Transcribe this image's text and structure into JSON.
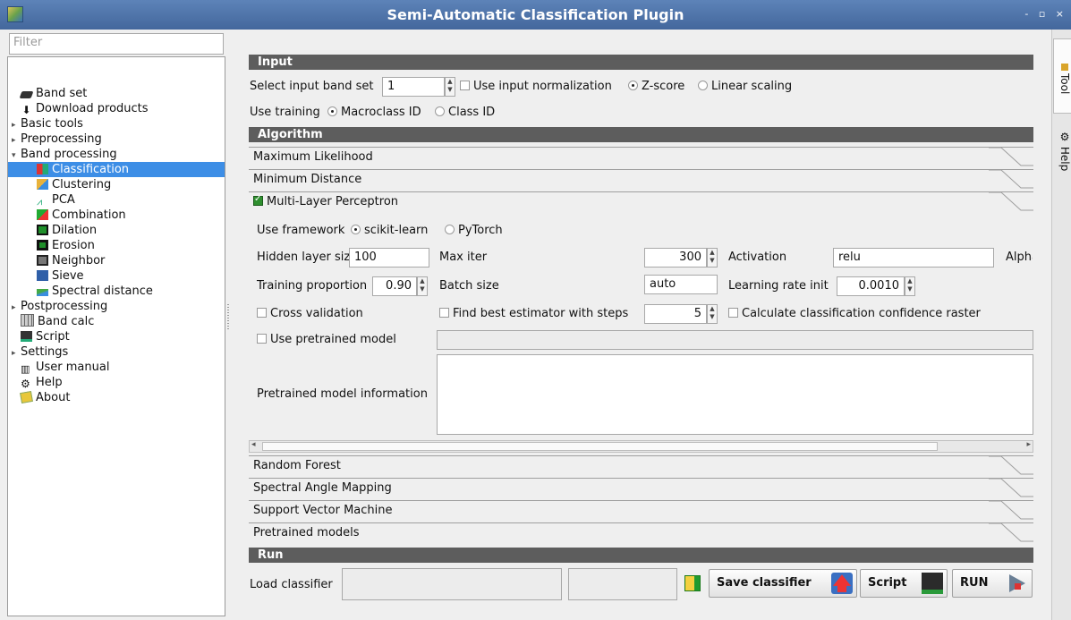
{
  "window": {
    "title": "Semi-Automatic Classification Plugin",
    "controls": "- ▫ ×"
  },
  "left": {
    "filter_placeholder": "Filter",
    "items": [
      {
        "label": "Band set",
        "icon": "band-set-icon"
      },
      {
        "label": "Download products",
        "icon": "download-icon"
      },
      {
        "label": "Basic tools",
        "icon": ""
      },
      {
        "label": "Preprocessing",
        "icon": ""
      },
      {
        "label": "Band processing",
        "icon": ""
      },
      {
        "label": "Classification",
        "icon": "classification-icon"
      },
      {
        "label": "Clustering",
        "icon": "clustering-icon"
      },
      {
        "label": "PCA",
        "icon": "pca-icon"
      },
      {
        "label": "Combination",
        "icon": "combination-icon"
      },
      {
        "label": "Dilation",
        "icon": "dilation-icon"
      },
      {
        "label": "Erosion",
        "icon": "erosion-icon"
      },
      {
        "label": "Neighbor",
        "icon": "neighbor-icon"
      },
      {
        "label": "Sieve",
        "icon": "sieve-icon"
      },
      {
        "label": "Spectral distance",
        "icon": "spectral-distance-icon"
      },
      {
        "label": "Postprocessing",
        "icon": ""
      },
      {
        "label": "Band calc",
        "icon": "band-calc-icon"
      },
      {
        "label": "Script",
        "icon": "script-icon"
      },
      {
        "label": "Settings",
        "icon": ""
      },
      {
        "label": "User manual",
        "icon": "user-manual-icon"
      },
      {
        "label": "Help",
        "icon": "help-icon"
      },
      {
        "label": "About",
        "icon": "about-icon"
      }
    ]
  },
  "dock": {
    "tool": "Tool",
    "help": "Help"
  },
  "input": {
    "header": "Input",
    "band_set_label": "Select input band set",
    "band_set_value": "1",
    "normalization_label": "Use input normalization",
    "zscore_label": "Z-score",
    "linear_label": "Linear scaling",
    "training_label": "Use training",
    "macroclass_label": "Macroclass ID",
    "class_label": "Class ID"
  },
  "algorithm": {
    "header": "Algorithm",
    "max_likelihood": "Maximum Likelihood",
    "min_distance": "Minimum Distance",
    "mlp": "Multi-Layer Perceptron",
    "random_forest": "Random Forest",
    "sam": "Spectral Angle Mapping",
    "svm": "Support Vector Machine",
    "pretrained": "Pretrained models"
  },
  "mlp": {
    "framework_label": "Use framework",
    "sklearn_label": "scikit-learn",
    "pytorch_label": "PyTorch",
    "hidden_label": "Hidden layer sizes",
    "hidden_value": "100",
    "maxiter_label": "Max iter",
    "maxiter_value": "300",
    "activation_label": "Activation",
    "activation_value": "relu",
    "alpha_label": "Alpha",
    "training_prop_label": "Training proportion",
    "training_prop_value": "0.90",
    "batch_label": "Batch size",
    "batch_value": "auto",
    "lr_label": "Learning rate init",
    "lr_value": "0.0010",
    "cross_label": "Cross validation",
    "best_label": "Find best estimator with steps",
    "best_value": "5",
    "confidence_label": "Calculate classification confidence raster",
    "pretrained_label": "Use pretrained model",
    "pretrained_info_label": "Pretrained model information"
  },
  "run": {
    "header": "Run",
    "load_label": "Load classifier",
    "save_label": "Save classifier",
    "script_label": "Script",
    "run_label": "RUN"
  }
}
